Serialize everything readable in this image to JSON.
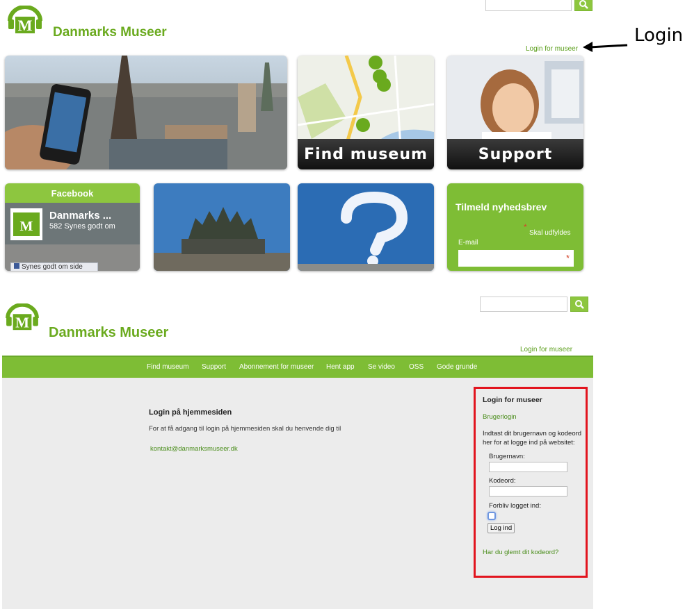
{
  "top_section": {
    "brand": "Danmarks Museer",
    "login_link": "Login for museer",
    "annotation_label": "Login",
    "tiles": {
      "find_museum": "Find museum",
      "support": "Support",
      "facebook_header": "Facebook",
      "facebook_page_name": "Danmarks ...",
      "facebook_likes": "582 Synes godt om",
      "facebook_like_button": "Synes godt om side",
      "newsletter_title": "Tilmeld nyhedsbrev",
      "newsletter_required": "Skal udfyldes",
      "newsletter_email_label": "E-mail"
    }
  },
  "bottom_section": {
    "brand": "Danmarks Museer",
    "login_link": "Login for museer",
    "search": {
      "value": "",
      "placeholder": ""
    },
    "nav": [
      "Find museum",
      "Support",
      "Abonnement for museer",
      "Hent app",
      "Se video",
      "OSS",
      "Gode grunde"
    ],
    "main": {
      "heading": "Login på hjemmesiden",
      "body": "For at få adgang til login på hjemmesiden skal du henvende dig til",
      "email": "kontakt@danmarksmuseer.dk"
    },
    "login_panel": {
      "title": "Login for museer",
      "subtitle": "Brugerlogin",
      "intro_line1": "Indtast dit brugernavn og kodeord",
      "intro_line2": "her for at logge ind på websitet:",
      "username_label": "Brugernavn:",
      "username_value": "",
      "password_label": "Kodeord:",
      "password_value": "",
      "remember_label": "Forbliv logget ind:",
      "remember_checked": false,
      "submit_label": "Log ind",
      "forgot_link": "Har du glemt dit kodeord?"
    }
  },
  "colors": {
    "brand_green": "#6aaa1e",
    "nav_green": "#7ebd35",
    "highlight_red": "#e2141e"
  }
}
